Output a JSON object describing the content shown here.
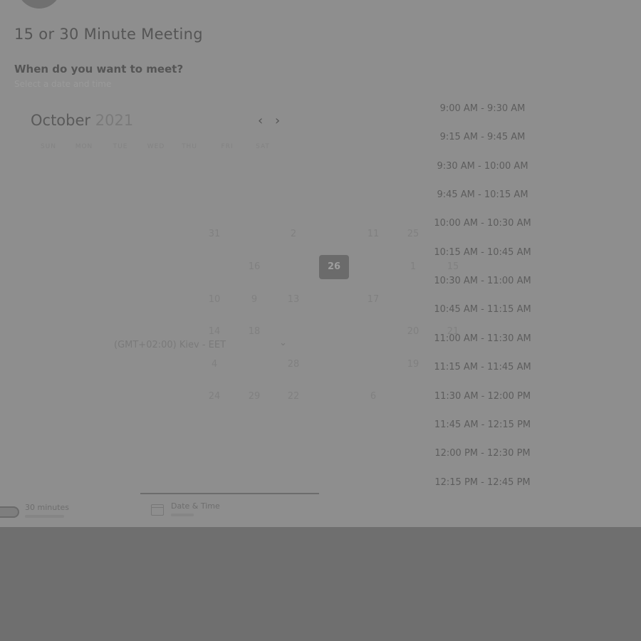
{
  "header": {
    "top_text": "",
    "meeting_title": "15 or 30 Minute Meeting",
    "question": "When do you want to meet?",
    "subtext": "Select a date and time"
  },
  "calendar": {
    "month": "October",
    "year": "2021",
    "prev_icon": "‹",
    "next_icon": "›",
    "weekdays": [
      "SUN",
      "MON",
      "TUE",
      "WED",
      "THU",
      "FRI",
      "SAT"
    ],
    "days": [
      {
        "label": "31"
      },
      {
        "label": "2"
      },
      {
        "label": "11"
      },
      {
        "label": "25"
      },
      {
        "label": "16"
      },
      {
        "label": "26",
        "selected": true
      },
      {
        "label": "1"
      },
      {
        "label": "15"
      },
      {
        "label": "10"
      },
      {
        "label": "9"
      },
      {
        "label": "13"
      },
      {
        "label": "17"
      },
      {
        "label": "14"
      },
      {
        "label": "18"
      },
      {
        "label": "20"
      },
      {
        "label": "21"
      },
      {
        "label": "4"
      },
      {
        "label": "28"
      },
      {
        "label": "19"
      },
      {
        "label": "24"
      },
      {
        "label": "29"
      },
      {
        "label": "22"
      },
      {
        "label": "6"
      }
    ],
    "timezone": "(GMT+02:00) Kiev - EET"
  },
  "time_slots": [
    "9:00 AM - 9:30 AM",
    "9:15 AM - 9:45 AM",
    "9:30 AM - 10:00 AM",
    "9:45 AM - 10:15 AM",
    "10:00 AM - 10:30 AM",
    "10:15 AM - 10:45 AM",
    "10:30 AM - 11:00 AM",
    "10:45 AM - 11:15 AM",
    "11:00 AM - 11:30 AM",
    "11:15 AM - 11:45 AM",
    "11:30 AM - 12:00 PM",
    "11:45 AM - 12:15 PM",
    "12:00 PM - 12:30 PM",
    "12:15 PM - 12:45 PM"
  ],
  "footer": {
    "duration_label": "30 minutes",
    "date_time_label": "Date & Time"
  },
  "icons": {
    "prev": "chevron-left-icon",
    "next": "chevron-right-icon",
    "timezone": "chevron-down-icon",
    "date_time": "calendar-icon"
  },
  "colors": {
    "overlay": "#8e8e8e",
    "selected_day": "#6b6b6b",
    "page_bottom": "#6f6f6f"
  }
}
